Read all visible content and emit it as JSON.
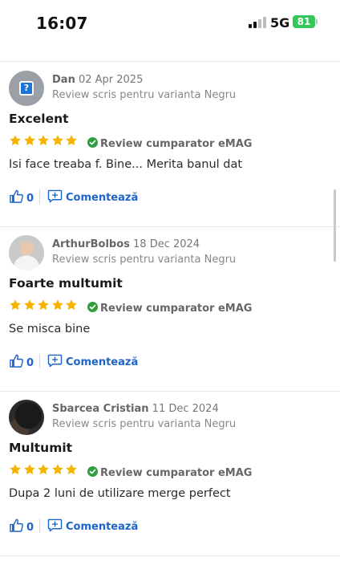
{
  "status_bar": {
    "time": "16:07",
    "network": "5G",
    "battery": "81"
  },
  "colors": {
    "link_blue": "#1e64c8",
    "star_yellow": "#f5b400",
    "verified_green": "#2e9e3e",
    "battery_green": "#34c759"
  },
  "reviews": [
    {
      "author": "Dan",
      "date": "02 Apr 2025",
      "variant": "Review scris pentru varianta Negru",
      "title": "Excelent",
      "rating": 5,
      "verified_label": "Review cumparator eMAG",
      "text": "Isi face treaba f. Bine... Merita banul dat",
      "likes": "0",
      "comment_label": "Comentează",
      "avatar": "placeholder"
    },
    {
      "author": "ArthurBolbos",
      "date": "18 Dec 2024",
      "variant": "Review scris pentru varianta Negru",
      "title": "Foarte multumit",
      "rating": 5,
      "verified_label": "Review cumparator eMAG",
      "text": "Se misca bine",
      "likes": "0",
      "comment_label": "Comentează",
      "avatar": "photo"
    },
    {
      "author": "Sbarcea Cristian",
      "date": "11 Dec 2024",
      "variant": "Review scris pentru varianta Negru",
      "title": "Multumit",
      "rating": 5,
      "verified_label": "Review cumparator eMAG",
      "text": "Dupa 2 luni de utilizare merge perfect",
      "likes": "0",
      "comment_label": "Comentează",
      "avatar": "photo"
    }
  ]
}
